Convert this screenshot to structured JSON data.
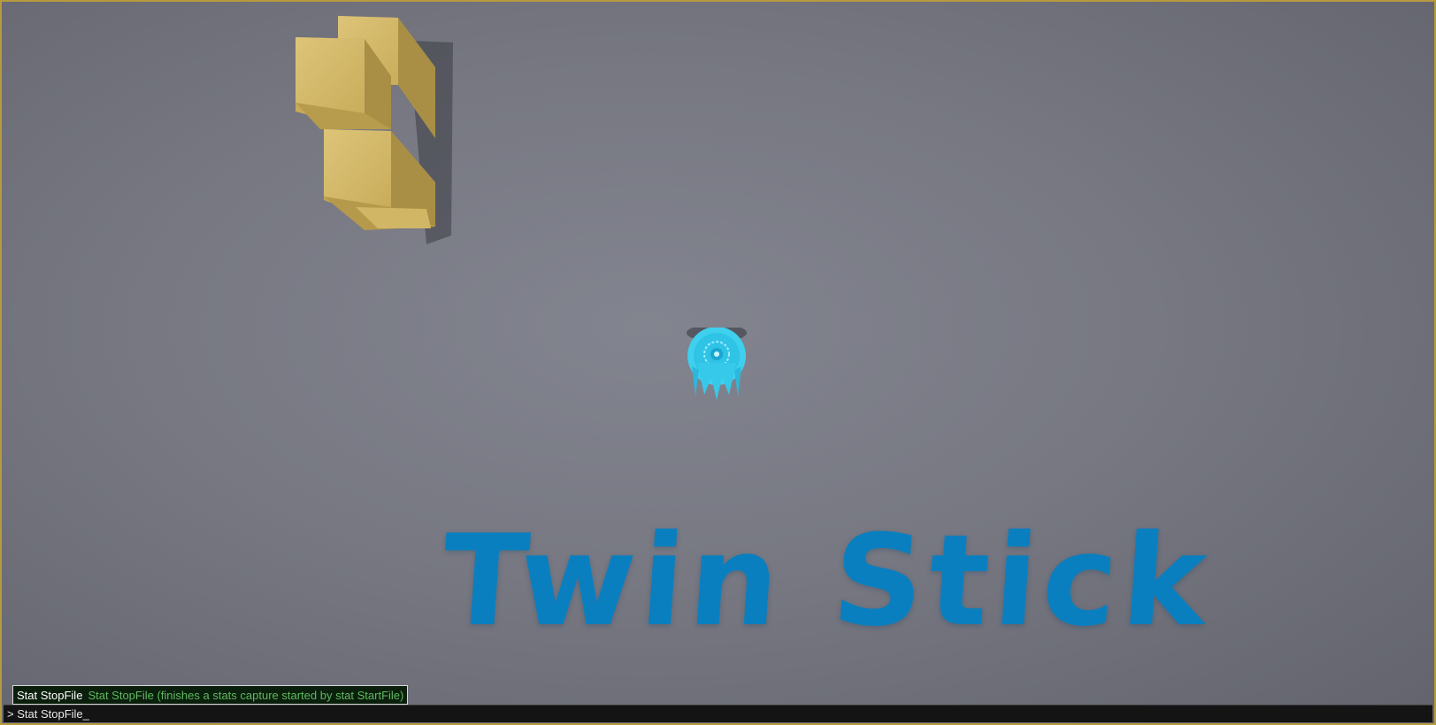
{
  "game": {
    "title_text": "Twin Stick",
    "title_color": "#0a7fc0",
    "block_color": "#d4b866",
    "ship_color": "#3fd0ee"
  },
  "console": {
    "prompt": "> ",
    "input_value": "Stat StopFile",
    "cursor": "_",
    "autocomplete": {
      "command": "Stat StopFile",
      "description": "Stat StopFile (finishes a stats capture started by stat StartFile)"
    }
  }
}
